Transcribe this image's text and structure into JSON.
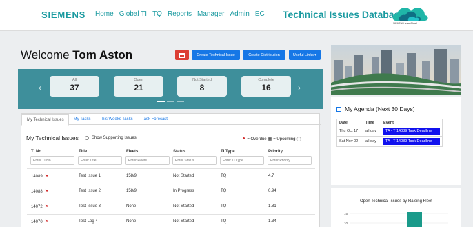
{
  "header": {
    "brand": "SIEMENS",
    "nav": [
      "Home",
      "Global TI",
      "TQ",
      "Reports",
      "Manager",
      "Admin",
      "EC"
    ],
    "app_title": "Technical Issues Database",
    "logo_caption": "SIEMENS smartCloud",
    "accent_color": "#1a9aa0"
  },
  "welcome": {
    "prefix": "Welcome",
    "user": "Tom Aston"
  },
  "buttons": {
    "calendar_icon": "calendar-icon",
    "create": "Create Technical Issue",
    "distribution": "Create Distribution",
    "links": "Useful Links ▾"
  },
  "stats": [
    {
      "label": "All",
      "value": "37"
    },
    {
      "label": "Open",
      "value": "21"
    },
    {
      "label": "Not Started",
      "value": "8"
    },
    {
      "label": "Complete",
      "value": "16"
    }
  ],
  "tabs": [
    "My Technical Issues",
    "My Tasks",
    "This Weeks Tasks",
    "Task Forecast"
  ],
  "panel": {
    "title": "My Technical Issues",
    "support_toggle": "Show Supporting Issues",
    "legend_overdue": "= Overdue",
    "legend_upcoming": "= Upcoming",
    "columns": [
      "TI No",
      "Title",
      "Fleets",
      "Status",
      "TI Type",
      "Priority"
    ],
    "filters": [
      "Enter TI No...",
      "Enter Title...",
      "Enter Fleets...",
      "Enter Status...",
      "Enter TI Type...",
      "Enter Priority..."
    ],
    "rows": [
      [
        "14089",
        "Test Issue 1",
        "158/9",
        "Not Started",
        "TQ",
        "4.7"
      ],
      [
        "14088",
        "Test Issue 2",
        "158/9",
        "In Progress",
        "TQ",
        "0.94"
      ],
      [
        "14072",
        "Test Issue 3",
        "None",
        "Not Started",
        "TQ",
        "1.81"
      ],
      [
        "14070",
        "Test Log 4",
        "None",
        "Not Started",
        "TQ",
        "1.34"
      ]
    ]
  },
  "agenda": {
    "title": "My Agenda (Next 30 Days)",
    "headers": [
      "Date",
      "Time",
      "Event"
    ],
    "items": [
      {
        "date": "Thu Oct 17",
        "time": "all day",
        "event": "TA - TI14089 Task Deadline"
      },
      {
        "date": "Sat Nov 02",
        "time": "all day",
        "event": "TA - TI14089 Task Deadline"
      }
    ]
  },
  "chart": {
    "title": "Open Technical Issues by Raising Fleet",
    "ticks": [
      "15",
      "10"
    ]
  }
}
